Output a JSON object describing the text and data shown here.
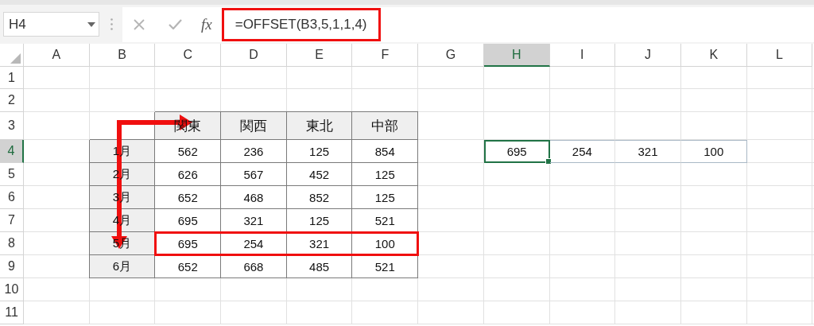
{
  "name_box": {
    "value": "H4"
  },
  "function_label": "fx",
  "formula": {
    "text": "=OFFSET(B3,5,1,1,4)",
    "highlighted": true
  },
  "columns": [
    {
      "label": "A",
      "selected": false
    },
    {
      "label": "B",
      "selected": false
    },
    {
      "label": "C",
      "selected": false
    },
    {
      "label": "D",
      "selected": false
    },
    {
      "label": "E",
      "selected": false
    },
    {
      "label": "F",
      "selected": false
    },
    {
      "label": "G",
      "selected": false
    },
    {
      "label": "H",
      "selected": true
    },
    {
      "label": "I",
      "selected": false
    },
    {
      "label": "J",
      "selected": false
    },
    {
      "label": "K",
      "selected": false
    },
    {
      "label": "L",
      "selected": false
    }
  ],
  "rows": [
    {
      "label": "1",
      "selected": false
    },
    {
      "label": "2",
      "selected": false
    },
    {
      "label": "3",
      "selected": false
    },
    {
      "label": "4",
      "selected": true
    },
    {
      "label": "5",
      "selected": false
    },
    {
      "label": "6",
      "selected": false
    },
    {
      "label": "7",
      "selected": false
    },
    {
      "label": "8",
      "selected": false
    },
    {
      "label": "9",
      "selected": false
    },
    {
      "label": "10",
      "selected": false
    },
    {
      "label": "11",
      "selected": false
    }
  ],
  "table": {
    "columns": [
      "関東",
      "関西",
      "東北",
      "中部"
    ],
    "rows": [
      {
        "label": "1月",
        "values": [
          "562",
          "236",
          "125",
          "854"
        ],
        "highlighted": false
      },
      {
        "label": "2月",
        "values": [
          "626",
          "567",
          "452",
          "125"
        ],
        "highlighted": false
      },
      {
        "label": "3月",
        "values": [
          "652",
          "468",
          "852",
          "125"
        ],
        "highlighted": false
      },
      {
        "label": "4月",
        "values": [
          "695",
          "321",
          "125",
          "521"
        ],
        "highlighted": false
      },
      {
        "label": "5月",
        "values": [
          "695",
          "254",
          "321",
          "100"
        ],
        "highlighted": true
      },
      {
        "label": "6月",
        "values": [
          "652",
          "668",
          "485",
          "521"
        ],
        "highlighted": false
      }
    ]
  },
  "result": [
    {
      "text": "695",
      "selected": true
    },
    {
      "text": "254",
      "selected": false
    },
    {
      "text": "321",
      "selected": false
    },
    {
      "text": "100",
      "selected": false
    }
  ]
}
